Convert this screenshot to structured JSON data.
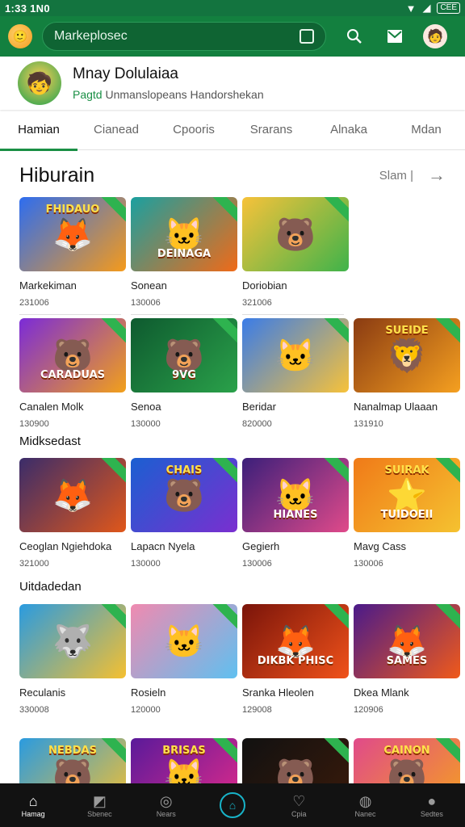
{
  "status_bar": {
    "time": "1:33 1N0",
    "battery": "CEE"
  },
  "app_bar": {
    "search_placeholder": "Markeplosec"
  },
  "profile": {
    "name": "Mnay Dolulaiaa",
    "sub_green": "Pagtd",
    "sub_rest": "Unmanslopeans Handorshekan"
  },
  "tabs": [
    {
      "label": "Hamian",
      "active": true
    },
    {
      "label": "Cianead",
      "active": false
    },
    {
      "label": "Cpooris",
      "active": false
    },
    {
      "label": "Srarans",
      "active": false
    },
    {
      "label": "Alnaka",
      "active": false
    },
    {
      "label": "Mdan",
      "active": false
    }
  ],
  "section": {
    "title": "Hiburain",
    "see_all": "Slam |"
  },
  "subheads": [
    "Midksedast",
    "Uitdadedan"
  ],
  "rows": [
    [
      {
        "name": "Markekiman",
        "num": "231006",
        "emoji": "🦊",
        "art_top": "FHIDAUO",
        "art": "",
        "bg": [
          "#2d6df0",
          "#f59a1b"
        ]
      },
      {
        "name": "Sonean",
        "num": "130006",
        "emoji": "🐱",
        "art_top": "",
        "art": "DEINAGA",
        "bg": [
          "#1aa0a0",
          "#f06a18"
        ]
      },
      {
        "name": "Doriobian",
        "num": "321006",
        "emoji": "🐻",
        "art_top": "",
        "art": "",
        "bg": [
          "#f7c23a",
          "#3fb34a"
        ]
      },
      null
    ],
    [
      {
        "name": "Canalen Molk",
        "num": "130900",
        "emoji": "🐻",
        "art_top": "",
        "art": "CARADUAS",
        "bg": [
          "#7b2bd8",
          "#f2a01a"
        ]
      },
      {
        "name": "Senoa",
        "num": "130000",
        "emoji": "🐻",
        "art_top": "",
        "art": "9VG",
        "bg": [
          "#0e5a2f",
          "#2aa14a"
        ]
      },
      {
        "name": "Beridar",
        "num": "820000",
        "emoji": "🐱",
        "art_top": "",
        "art": "",
        "bg": [
          "#3a7ce8",
          "#f7c23a"
        ]
      },
      {
        "name": "Nanalmap Ulaaan",
        "num": "131910",
        "emoji": "🦁",
        "art_top": "SUEIDE",
        "art": "",
        "bg": [
          "#8a3b12",
          "#f5a020"
        ]
      }
    ],
    [
      {
        "name": "Ceoglan Ngiehdoka",
        "num": "321000",
        "emoji": "🦊",
        "art_top": "",
        "art": "",
        "bg": [
          "#3a2c6a",
          "#e0571a"
        ]
      },
      {
        "name": "Lapacn Nyela",
        "num": "130000",
        "emoji": "🐻",
        "art_top": "CHAIS",
        "art": "",
        "bg": [
          "#1b5fd1",
          "#7a2fd0"
        ]
      },
      {
        "name": "Gegierh",
        "num": "130006",
        "emoji": "🐱",
        "art_top": "",
        "art": "HIANES",
        "bg": [
          "#3b1f7a",
          "#e04a8a"
        ]
      },
      {
        "name": "Mavg Cass",
        "num": "130006",
        "emoji": "⭐",
        "art_top": "SUIRAK",
        "art": "TUIDOEII",
        "bg": [
          "#f07a18",
          "#f5c230"
        ]
      }
    ],
    [
      {
        "name": "Reculanis",
        "num": "330008",
        "emoji": "🐺",
        "art_top": "",
        "art": "",
        "bg": [
          "#2a9be0",
          "#f5c030"
        ]
      },
      {
        "name": "Rosieln",
        "num": "120000",
        "emoji": "🐱",
        "art_top": "",
        "art": "",
        "bg": [
          "#f08ab0",
          "#5fc0f0"
        ]
      },
      {
        "name": "Sranka Hleolen",
        "num": "129008",
        "emoji": "🦊",
        "art_top": "",
        "art": "DIKBK PHISC",
        "bg": [
          "#7a140a",
          "#f0521a"
        ]
      },
      {
        "name": "Dkea Mlank",
        "num": "120906",
        "emoji": "🦊",
        "art_top": "",
        "art": "SAMES",
        "bg": [
          "#4a1a8a",
          "#f05a1a"
        ]
      }
    ],
    [
      {
        "name": "",
        "num": "",
        "emoji": "🐻",
        "art_top": "NEBDAS",
        "art": "",
        "bg": [
          "#2a9be0",
          "#f5c030"
        ]
      },
      {
        "name": "",
        "num": "",
        "emoji": "🐱",
        "art_top": "BRISAS",
        "art": "",
        "bg": [
          "#5a1a9a",
          "#e02a8a"
        ]
      },
      {
        "name": "",
        "num": "",
        "emoji": "🐻",
        "art_top": "",
        "art": "",
        "bg": [
          "#111111",
          "#3a1a0a"
        ]
      },
      {
        "name": "",
        "num": "",
        "emoji": "🐻",
        "art_top": "CAINON",
        "art": "",
        "bg": [
          "#e04a8a",
          "#f5a020"
        ]
      }
    ]
  ],
  "bottom_nav": [
    {
      "label": "Hamag",
      "icon": "home-icon",
      "glyph": "⌂",
      "active": true
    },
    {
      "label": "Sbenec",
      "icon": "chart-icon",
      "glyph": "◩",
      "active": false
    },
    {
      "label": "Nears",
      "icon": "compass-icon",
      "glyph": "◎",
      "active": false
    },
    {
      "label": "",
      "icon": "center-icon",
      "glyph": "⌂",
      "active": false,
      "center": true
    },
    {
      "label": "Cpia",
      "icon": "bag-icon",
      "glyph": "♡",
      "active": false
    },
    {
      "label": "Nanec",
      "icon": "game-icon",
      "glyph": "◍",
      "active": false
    },
    {
      "label": "Sedtes",
      "icon": "profile-icon",
      "glyph": "●",
      "active": false
    }
  ]
}
